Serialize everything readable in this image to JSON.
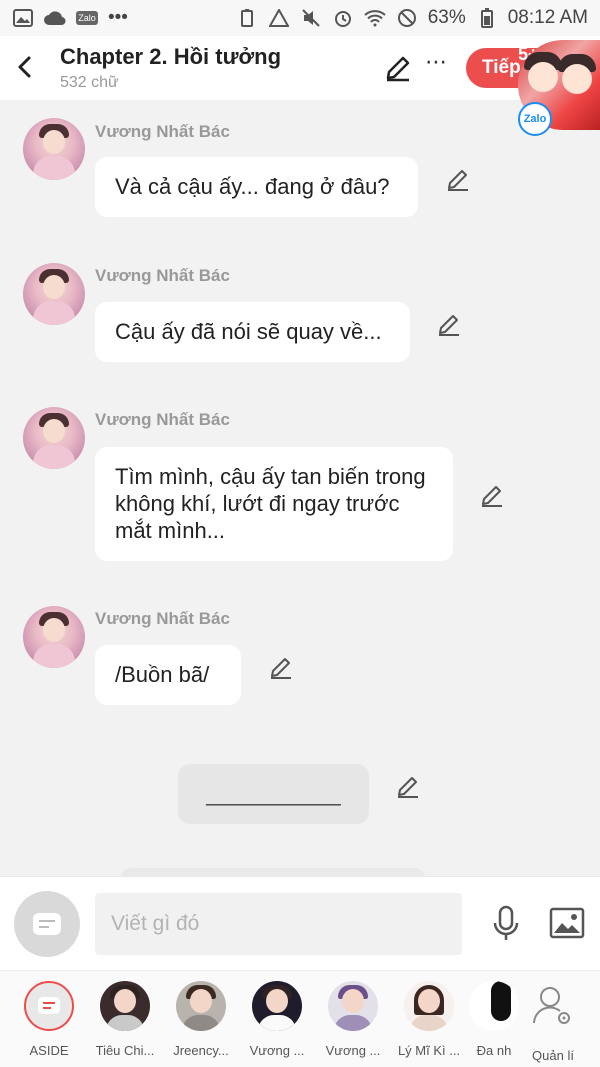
{
  "status_bar": {
    "battery": "63%",
    "time": "08:12 AM",
    "app_badge": "Zalo",
    "overflow": "•••"
  },
  "header": {
    "title": "Chapter 2. Hồi tưởng",
    "subtitle": "532 chữ",
    "more_label": "⋯",
    "next_label": "Tiếp",
    "badge": "5+",
    "floating_badge": "Zalo"
  },
  "messages": [
    {
      "author": "Vương Nhất Bác",
      "text": "Và cả cậu ấy... đang ở đâu?"
    },
    {
      "author": "Vương Nhất Bác",
      "text": "Cậu ấy đã nói sẽ quay về..."
    },
    {
      "author": "Vương Nhất Bác",
      "text": "Tìm mình, cậu ấy tan biến trong không khí, lướt đi ngay trước mắt mình..."
    },
    {
      "author": "Vương Nhất Bác",
      "text": "/Buồn bã/"
    }
  ],
  "separator": {
    "text": "___________"
  },
  "composer": {
    "placeholder": "Viết gì đó"
  },
  "characters": [
    {
      "label": "ASIDE"
    },
    {
      "label": "Tiêu Chi..."
    },
    {
      "label": "Jreency..."
    },
    {
      "label": "Vương ..."
    },
    {
      "label": "Vương ..."
    },
    {
      "label": "Lý Mĩ Kì ..."
    },
    {
      "label": "Đa nh"
    },
    {
      "label": "Quản lí"
    }
  ],
  "colors": {
    "accent": "#ec4d4d",
    "background": "#f2f2f2",
    "zalo_blue": "#1b8df5"
  }
}
